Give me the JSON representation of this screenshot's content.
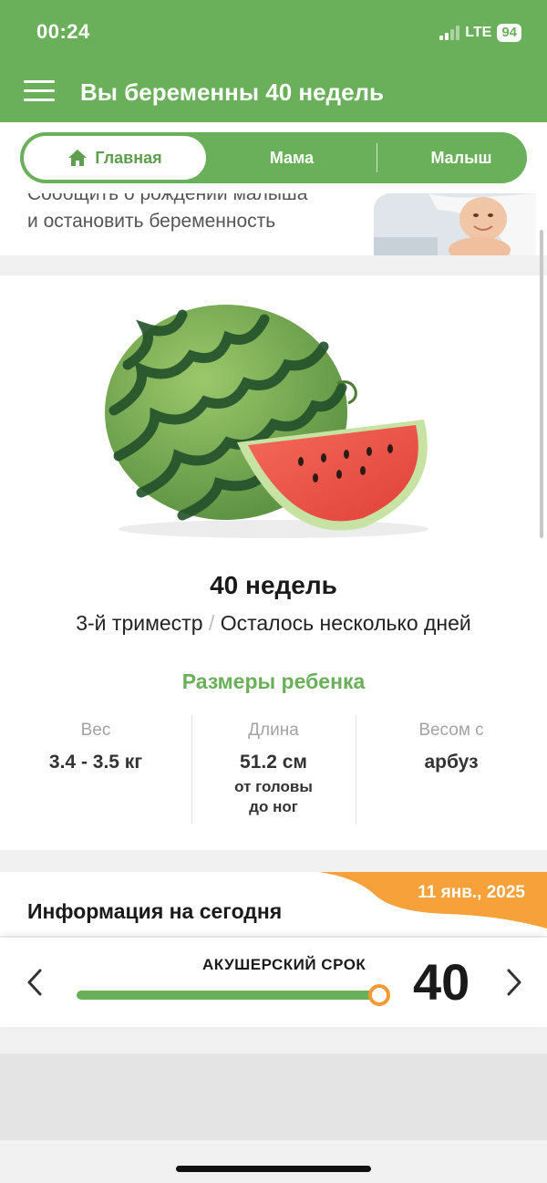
{
  "status_bar": {
    "time": "00:24",
    "network": "LTE",
    "battery": "94"
  },
  "header": {
    "title": "Вы беременны 40 недель"
  },
  "tabs": [
    {
      "label": "Главная",
      "icon": "home-icon",
      "active": true
    },
    {
      "label": "Мама",
      "active": false
    },
    {
      "label": "Малыш",
      "active": false
    }
  ],
  "banner": {
    "line1": "Сообщить о рождении малыша",
    "line2": "и остановить беременность"
  },
  "week": {
    "title": "40 недель",
    "trimester": "3-й триместр",
    "separator": "/",
    "remaining": "Осталось несколько дней",
    "image": "watermelon"
  },
  "sizes": {
    "title": "Размеры ребенка",
    "weight": {
      "label": "Вес",
      "value": "3.4 - 3.5 кг"
    },
    "length": {
      "label": "Длина",
      "value": "51.2 см",
      "note_line1": "от головы",
      "note_line2": "до ног"
    },
    "compare": {
      "label": "Весом с",
      "value": "арбуз"
    }
  },
  "info": {
    "title": "Информация на сегодня",
    "date": "11 янв., 2025"
  },
  "term": {
    "label": "АКУШЕРСКИЙ СРОК",
    "value": "40",
    "progress": 0.98
  },
  "colors": {
    "brand_green": "#6aaf5a",
    "accent_orange": "#f49a33"
  }
}
